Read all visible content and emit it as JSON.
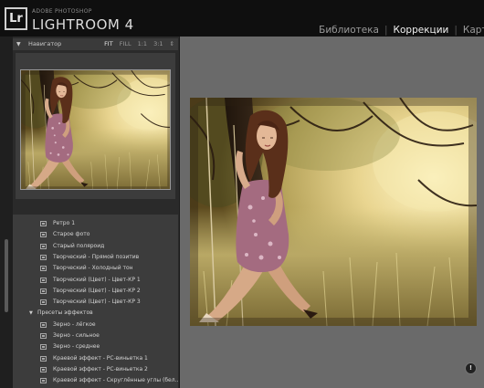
{
  "app": {
    "logo": "Lr",
    "brand_small": "ADOBE PHOTOSHOP",
    "brand_big": "LIGHTROOM 4"
  },
  "modules": [
    {
      "label": "Библиотека",
      "active": false
    },
    {
      "label": "Коррекции",
      "active": true
    },
    {
      "label": "Карта",
      "active": false
    }
  ],
  "navigator": {
    "title": "Навигатор",
    "zoom_options": [
      "FIT",
      "FILL",
      "1:1",
      "3:1"
    ],
    "selected_zoom": "FIT"
  },
  "presets": [
    {
      "label": "Ретро 1",
      "type": "preset"
    },
    {
      "label": "Старое фото",
      "type": "preset"
    },
    {
      "label": "Старый поляроид",
      "type": "preset"
    },
    {
      "label": "Творческий - Прямой позитив",
      "type": "preset"
    },
    {
      "label": "Творческий - Холодный тон",
      "type": "preset"
    },
    {
      "label": "Творческий (Цвет) - Цвет-КР 1",
      "type": "preset"
    },
    {
      "label": "Творческий (Цвет) - Цвет-КР 2",
      "type": "preset"
    },
    {
      "label": "Творческий (Цвет) - Цвет-КР 3",
      "type": "preset"
    },
    {
      "label": "Пресеты эффектов",
      "type": "folder"
    },
    {
      "label": "Зерно - лёгкое",
      "type": "preset"
    },
    {
      "label": "Зерно - сильное",
      "type": "preset"
    },
    {
      "label": "Зерно - среднее",
      "type": "preset"
    },
    {
      "label": "Краевой эффект - РС-виньетка 1",
      "type": "preset"
    },
    {
      "label": "Краевой эффект - РС-виньетка 2",
      "type": "preset"
    },
    {
      "label": "Краевой эффект - Скруглённые углы (бел...",
      "type": "preset"
    }
  ],
  "info_button": "!",
  "icons": {
    "panel_collapse": "triangle-down-icon",
    "preset": "preset-icon",
    "folder": "folder-triangle-icon",
    "info": "info-icon"
  },
  "colors": {
    "topbar_bg": "#0f0f0f",
    "panel_bg": "#3c3c3c",
    "workspace_bg": "#6a6a6a",
    "active_module": "#f2f2f2"
  }
}
